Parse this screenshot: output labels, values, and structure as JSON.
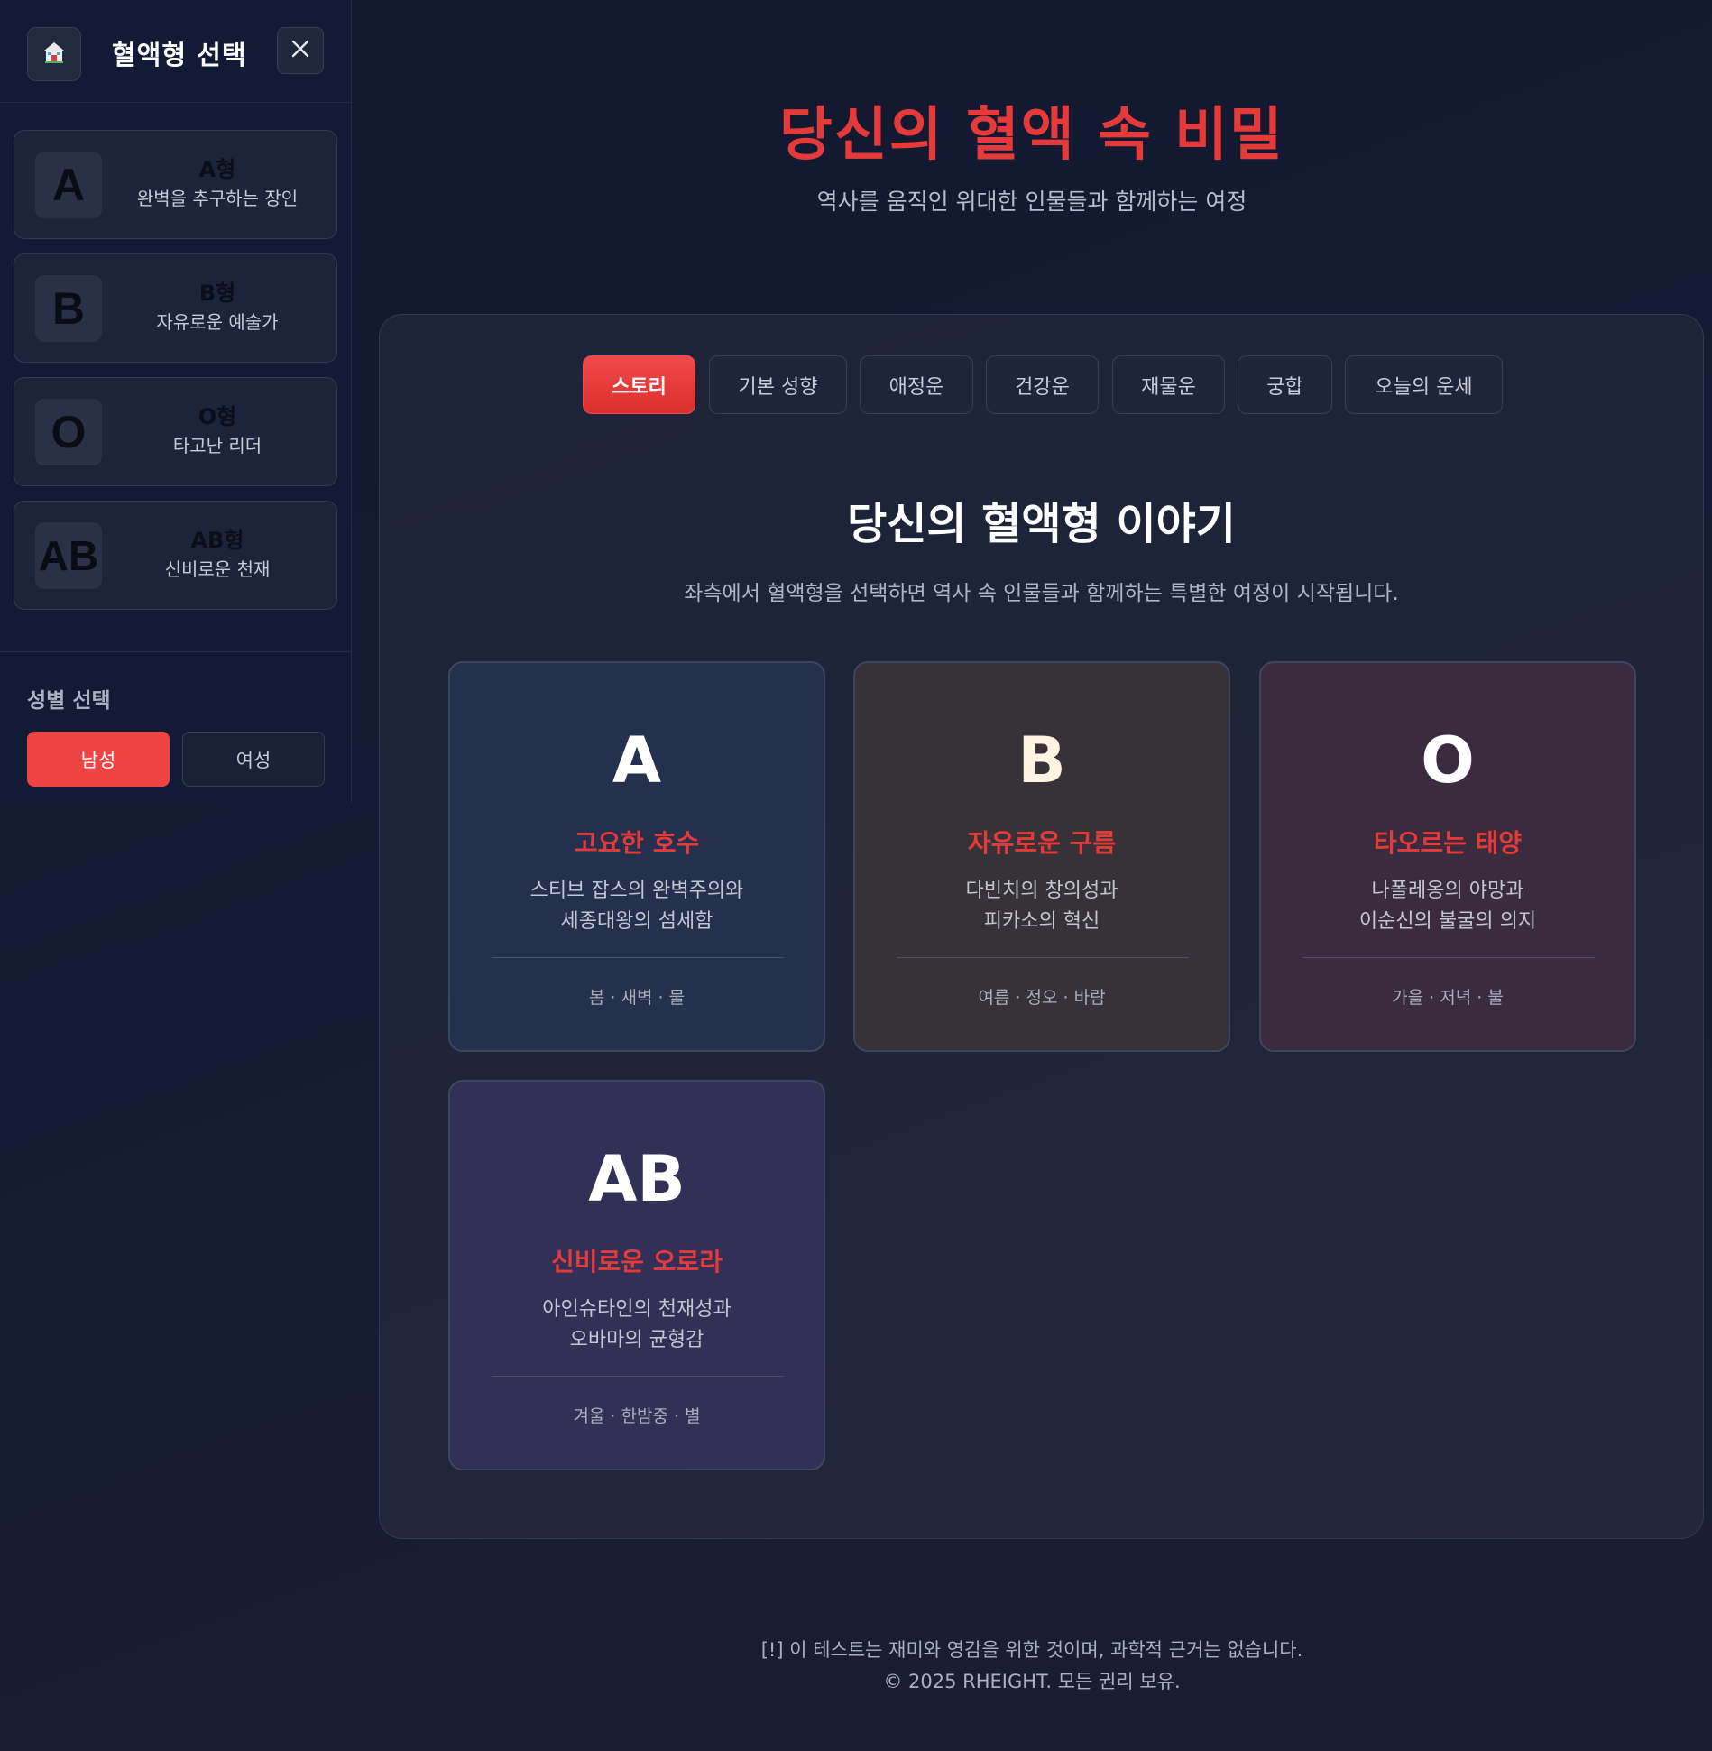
{
  "sidebar": {
    "title": "혈액형 선택",
    "home_icon": "home-icon",
    "close_icon": "close-icon",
    "types": [
      {
        "letter": "A",
        "name": "A형",
        "desc": "완벽을 추구하는 장인"
      },
      {
        "letter": "B",
        "name": "B형",
        "desc": "자유로운 예술가"
      },
      {
        "letter": "O",
        "name": "O형",
        "desc": "타고난 리더"
      },
      {
        "letter": "AB",
        "name": "AB형",
        "desc": "신비로운 천재"
      }
    ],
    "gender": {
      "title": "성별 선택",
      "male": "남성",
      "female": "여성",
      "selected": "남성"
    }
  },
  "header": {
    "title": "당신의 혈액 속 비밀",
    "subtitle": "역사를 움직인 위대한 인물들과 함께하는 여정"
  },
  "tabs": [
    {
      "label": "스토리",
      "active": true
    },
    {
      "label": "기본 성향",
      "active": false
    },
    {
      "label": "애정운",
      "active": false
    },
    {
      "label": "건강운",
      "active": false
    },
    {
      "label": "재물운",
      "active": false
    },
    {
      "label": "궁합",
      "active": false
    },
    {
      "label": "오늘의 운세",
      "active": false
    }
  ],
  "story": {
    "title": "당신의 혈액형 이야기",
    "subtitle": "좌측에서 혈액형을 선택하면 역사 속 인물들과 함께하는 특별한 여정이 시작됩니다.",
    "cards": [
      {
        "letter": "A",
        "name": "고요한 호수",
        "desc_line1": "스티브 잡스의 완벽주의와",
        "desc_line2": "세종대왕의 섬세함",
        "tags": "봄 · 새벽 · 물"
      },
      {
        "letter": "B",
        "name": "자유로운 구름",
        "desc_line1": "다빈치의 창의성과",
        "desc_line2": "피카소의 혁신",
        "tags": "여름 · 정오 · 바람"
      },
      {
        "letter": "O",
        "name": "타오르는 태양",
        "desc_line1": "나폴레옹의 야망과",
        "desc_line2": "이순신의 불굴의 의지",
        "tags": "가을 · 저녁 · 불"
      },
      {
        "letter": "AB",
        "name": "신비로운 오로라",
        "desc_line1": "아인슈타인의 천재성과",
        "desc_line2": "오바마의 균형감",
        "tags": "겨울 · 한밤중 · 별"
      }
    ]
  },
  "footer": {
    "disclaimer": "[!] 이 테스트는 재미와 영감을 위한 것이며, 과학적 근거는 없습니다.",
    "copyright": "© 2025 RHEIGHT. 모든 권리 보유."
  },
  "colors": {
    "accent": "#ef4444",
    "title_red": "#e53a3a",
    "background": "#141a31",
    "panel": "#1f2437"
  }
}
